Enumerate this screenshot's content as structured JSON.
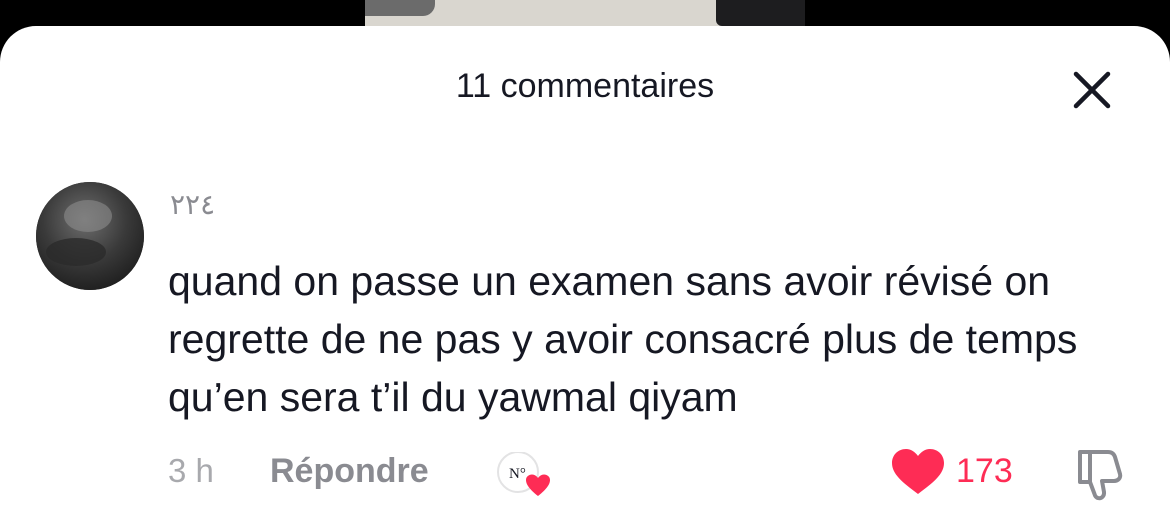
{
  "header": {
    "title": "11 commentaires"
  },
  "comment": {
    "username": "٢٢٤",
    "text": "quand on passe un examen sans avoir révisé on regrette de ne pas y avoir consacré plus de temps qu’en sera t’il du yawmal qiyam",
    "time": "3 h",
    "reply_label": "Répondre",
    "like_count": "173",
    "creator_badge_text": "N°"
  },
  "icons": {
    "close": "close-icon",
    "heart": "heart-icon",
    "dislike": "thumbs-down-icon",
    "creator_liked": "creator-liked-icon"
  },
  "colors": {
    "like": "#fe2c55",
    "text": "#161823",
    "secondary": "#8a8b91"
  }
}
